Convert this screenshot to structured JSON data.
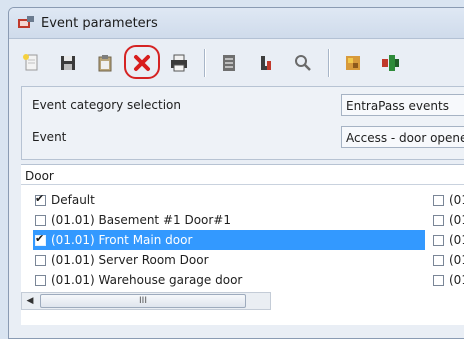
{
  "window": {
    "title": "Event parameters"
  },
  "toolbar": {
    "buttons": [
      {
        "icon": "new-document-icon"
      },
      {
        "icon": "save-icon"
      },
      {
        "icon": "clipboard-icon"
      },
      {
        "icon": "delete-icon"
      },
      {
        "icon": "print-icon"
      },
      {
        "icon": "list-icon"
      },
      {
        "icon": "tree-icon"
      },
      {
        "icon": "search-icon"
      },
      {
        "icon": "tools-icon"
      },
      {
        "icon": "network-icon"
      }
    ]
  },
  "params": {
    "category_label": "Event category selection",
    "category_value": "EntraPass events",
    "event_label": "Event",
    "event_value": "Access - door opened"
  },
  "doors": {
    "header": "Door",
    "items": [
      {
        "label": "Default",
        "checked": true,
        "selected": false
      },
      {
        "label": "(01.01) Basement #1 Door#1",
        "checked": false,
        "selected": false
      },
      {
        "label": "(01.01) Front Main door",
        "checked": true,
        "selected": true
      },
      {
        "label": "(01.01) Server Room Door",
        "checked": false,
        "selected": false
      },
      {
        "label": "(01.01) Warehouse garage door",
        "checked": false,
        "selected": false
      }
    ],
    "right_column": [
      "(01.",
      "(01.",
      "(01.",
      "(01.",
      "(01."
    ]
  },
  "scrollbar": {
    "left_arrow": "◀",
    "grip": "III"
  },
  "colors": {
    "selection": "#3399ff",
    "highlight_ring": "#d52323"
  }
}
